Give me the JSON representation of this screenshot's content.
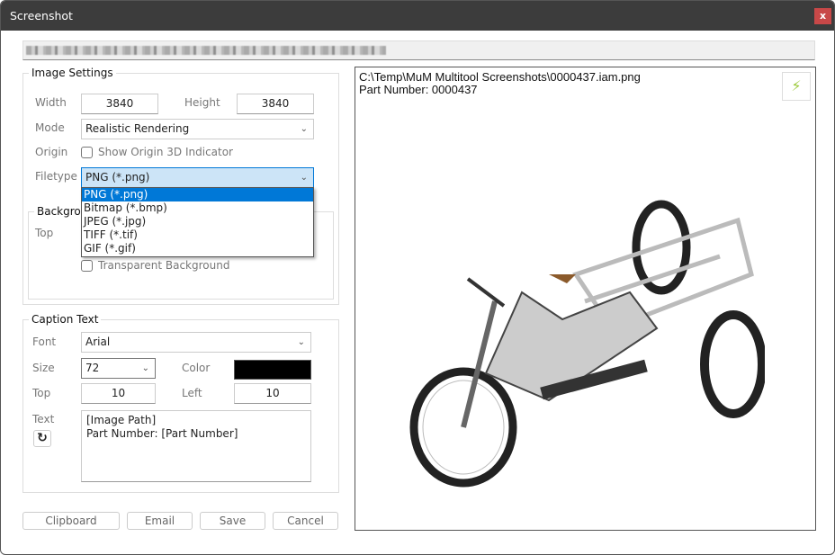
{
  "window": {
    "title": "Screenshot",
    "close_label": "x"
  },
  "path_bar": {
    "value_obscured": true
  },
  "image_settings": {
    "legend": "Image Settings",
    "width_label": "Width",
    "width_value": "3840",
    "height_label": "Height",
    "height_value": "3840",
    "mode_label": "Mode",
    "mode_value": "Realistic Rendering",
    "origin_label": "Origin",
    "origin_checkbox": "Show Origin 3D Indicator",
    "origin_checked": false,
    "filetype_label": "Filetype",
    "filetype_value": "PNG (*.png)",
    "filetype_options": [
      "PNG (*.png)",
      "Bitmap (*.bmp)",
      "JPEG (*.jpg)",
      "TIFF (*.tif)",
      "GIF (*.gif)"
    ]
  },
  "background": {
    "legend": "Background",
    "top_label": "Top",
    "transparent_label": "Transparent Background",
    "transparent_checked": false
  },
  "caption_text": {
    "legend": "Caption Text",
    "font_label": "Font",
    "font_value": "Arial",
    "size_label": "Size",
    "size_value": "72",
    "color_label": "Color",
    "color_value": "#000000",
    "top_label": "Top",
    "top_value": "10",
    "left_label": "Left",
    "left_value": "10",
    "text_label": "Text",
    "text_line1": "[Image Path]",
    "text_line2": "Part Number: [Part Number]"
  },
  "buttons": {
    "clipboard": "Clipboard",
    "email": "Email",
    "save": "Save",
    "cancel": "Cancel"
  },
  "preview": {
    "line1": "C:\\Temp\\MuM Multitool Screenshots\\0000437.iam.png",
    "line2": "Part Number: 0000437",
    "refresh_icon": "lightning-bolt-icon",
    "accent": "#9cc93a"
  }
}
